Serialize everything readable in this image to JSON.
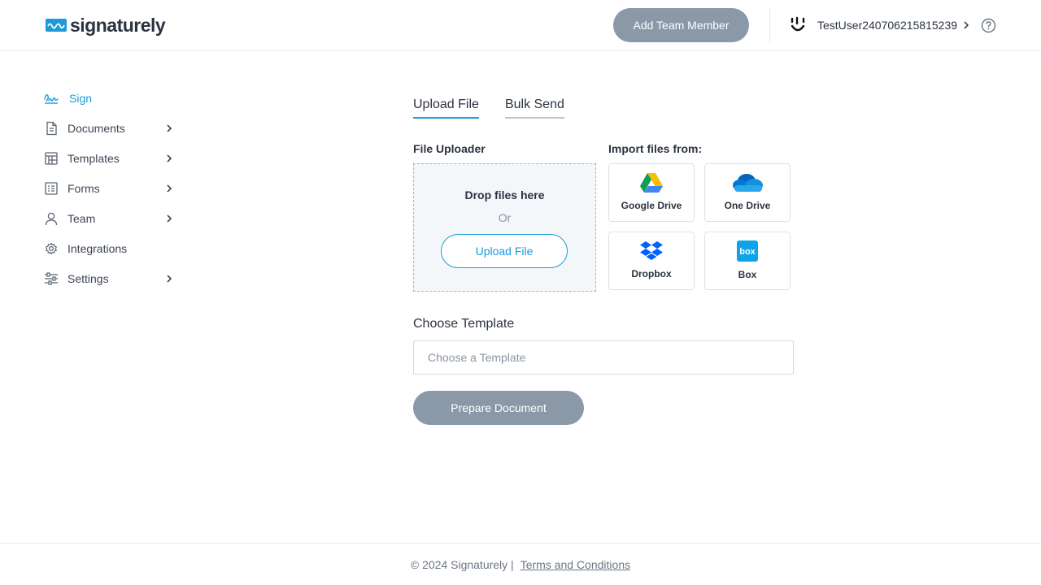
{
  "header": {
    "brand": "signaturely",
    "add_member_label": "Add Team Member",
    "user_name": "TestUser240706215815239"
  },
  "sidebar": {
    "items": [
      {
        "label": "Sign",
        "icon": "signature-icon",
        "active": true
      },
      {
        "label": "Documents",
        "icon": "document-icon",
        "expandable": true
      },
      {
        "label": "Templates",
        "icon": "templates-icon",
        "expandable": true
      },
      {
        "label": "Forms",
        "icon": "forms-icon",
        "expandable": true
      },
      {
        "label": "Team",
        "icon": "user-icon",
        "expandable": true
      },
      {
        "label": "Integrations",
        "icon": "gear-icon"
      },
      {
        "label": "Settings",
        "icon": "sliders-icon",
        "expandable": true
      }
    ]
  },
  "tabs": [
    {
      "label": "Upload File",
      "active": true
    },
    {
      "label": "Bulk Send",
      "active": false
    }
  ],
  "uploader": {
    "title": "File Uploader",
    "drop_text": "Drop files here",
    "or_text": "Or",
    "button_label": "Upload File"
  },
  "import": {
    "title": "Import files from:",
    "sources": [
      {
        "label": "Google Drive",
        "icon": "google-drive-icon"
      },
      {
        "label": "One Drive",
        "icon": "onedrive-icon"
      },
      {
        "label": "Dropbox",
        "icon": "dropbox-icon"
      },
      {
        "label": "Box",
        "icon": "box-icon"
      }
    ]
  },
  "template": {
    "title": "Choose Template",
    "placeholder": "Choose a Template"
  },
  "prepare_label": "Prepare Document",
  "footer": {
    "copyright": "© 2024 Signaturely |",
    "terms": "Terms and Conditions"
  },
  "colors": {
    "accent": "#1c9bd7",
    "disabled_button": "#8a98a8",
    "text": "#2b3340"
  }
}
